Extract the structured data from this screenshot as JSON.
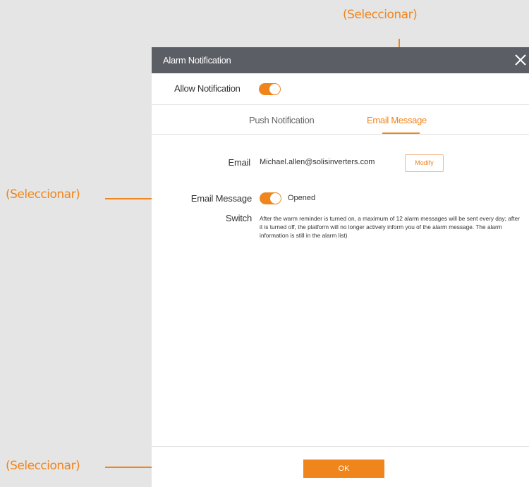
{
  "annotations": {
    "top_label": "(Seleccionar)",
    "left_label_1": "(Seleccionar)",
    "left_label_2": "(Seleccionar)"
  },
  "dialog": {
    "title": "Alarm Notification",
    "allow_notification_label": "Allow Notification",
    "allow_notification_on": true,
    "tabs": [
      {
        "label": "Push Notification",
        "active": false
      },
      {
        "label": "Email Message",
        "active": true
      }
    ],
    "email_label": "Email",
    "email_value": "Michael.allen@solisinverters.com",
    "modify_label": "Modify",
    "switch_label_line1": "Email Message",
    "switch_label_line2": "Switch",
    "switch_on": true,
    "switch_status": "Opened",
    "description": "After the warm reminder is turned on, a maximum of 12 alarm messages will be sent every day; after it is turned off, the platform will no longer actively inform you of the alarm message. The alarm information is still in the alarm list)",
    "ok_label": "OK"
  },
  "colors": {
    "accent": "#f0851b",
    "header_bg": "#5c5e66",
    "page_bg": "#e5e5e5"
  }
}
